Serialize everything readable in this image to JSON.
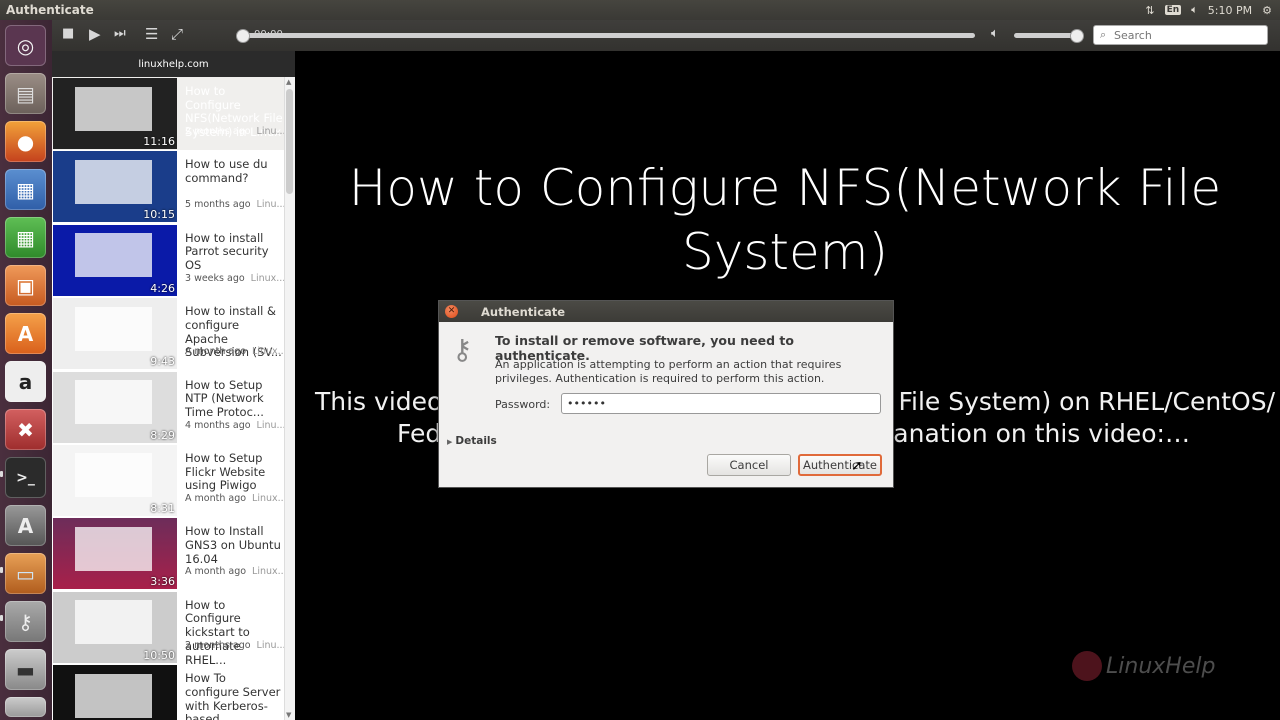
{
  "top_panel": {
    "title": "Authenticate",
    "keyboard": "En",
    "clock": "5:10 PM",
    "icons": [
      "network-icon",
      "keyboard-icon",
      "volume-icon",
      "settings-icon"
    ]
  },
  "launcher": {
    "items": [
      "ubuntu-dash-icon",
      "files-icon",
      "firefox-icon",
      "writer-icon",
      "calc-icon",
      "impress-icon",
      "software-center-icon",
      "amazon-icon",
      "system-settings-icon",
      "terminal-icon",
      "updater-icon",
      "video-player-icon",
      "passwords-icon",
      "disk-icon",
      "trash-icon"
    ]
  },
  "player": {
    "time": "00:00",
    "seek_fraction": 0,
    "volume_fraction": 1,
    "search_placeholder": "Search"
  },
  "playlist": {
    "header": "linuxhelp.com",
    "items": [
      {
        "title": "How to Configure NFS(Network File System) in Linux",
        "age": "2 months ago",
        "channel": "Linu...",
        "duration": "11:16",
        "selected": true
      },
      {
        "title": "How to use du command?",
        "age": "5 months ago",
        "channel": "Linu...",
        "duration": "10:15"
      },
      {
        "title": "How to install Parrot security OS",
        "age": "3 weeks ago",
        "channel": "Linux...",
        "duration": "4:26"
      },
      {
        "title": "How to install & configure Apache Subversion (SV...",
        "age": "A month ago",
        "channel": "Linux...",
        "duration": "9:43"
      },
      {
        "title": "How to Setup NTP (Network Time Protoc...",
        "age": "4 months ago",
        "channel": "Linu...",
        "duration": "8:29"
      },
      {
        "title": "How to Setup Flickr Website using Piwigo",
        "age": "A month ago",
        "channel": "Linux...",
        "duration": "8:31"
      },
      {
        "title": "How to Install GNS3 on Ubuntu 16.04",
        "age": "A month ago",
        "channel": "Linux...",
        "duration": "3:36"
      },
      {
        "title": "How to Configure kickstart to automate RHEL...",
        "age": "2 months ago",
        "channel": "Linu...",
        "duration": "10:50"
      },
      {
        "title": "How To configure Server with Kerberos-based...",
        "age": "",
        "channel": "",
        "duration": ""
      }
    ]
  },
  "video": {
    "title": "How to Configure NFS(Network File System)",
    "desc_left": "This video",
    "desc_right": "File System) on RHEL/CentOS/",
    "desc2_left": "Fed",
    "desc2_right": "lanation on this video:…",
    "watermark": "LinuxHelp"
  },
  "dialog": {
    "title": "Authenticate",
    "heading": "To install or remove software, you need to authenticate.",
    "body": "An application is attempting to perform an action that requires privileges. Authentication is required to perform this action.",
    "password_label": "Password:",
    "password_value": "••••••",
    "details_label": "Details",
    "cancel_label": "Cancel",
    "authenticate_label": "Authenticate"
  }
}
